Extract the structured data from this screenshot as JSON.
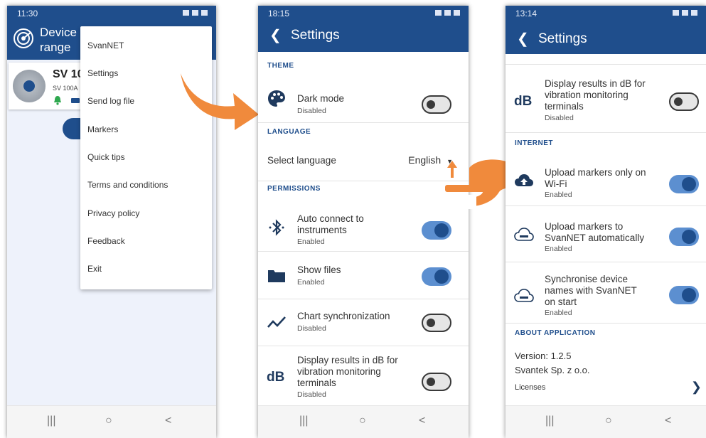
{
  "phone1": {
    "status_time": "11:30",
    "title": "Device\nrange",
    "title_line1": "Device",
    "title_line2": "range",
    "device_name": "SV 10",
    "device_model": "SV 100A",
    "menu_items": [
      "SvanNET",
      "Settings",
      "Send log file",
      "Markers",
      "Quick tips",
      "Terms and conditions",
      "Privacy policy",
      "Feedback",
      "Exit"
    ]
  },
  "phone2": {
    "status_time": "18:15",
    "title": "Settings",
    "theme_section": "THEME",
    "dark_mode_label": "Dark mode",
    "dark_mode_status": "Disabled",
    "language_section": "LANGUAGE",
    "select_language_label": "Select language",
    "language_value": "English",
    "permissions_section": "PERMISSIONS",
    "auto_connect_label_line1": "Auto connect to",
    "auto_connect_label_line2": "instruments",
    "auto_connect_status": "Enabled",
    "show_files_label": "Show files",
    "show_files_status": "Enabled",
    "chart_sync_label": "Chart synchronization",
    "chart_sync_status": "Disabled",
    "db_label_line1": "Display results in dB for",
    "db_label_line2": "vibration monitoring",
    "db_label_line3": "terminals",
    "db_status": "Disabled",
    "db_icon_text": "dB"
  },
  "phone3": {
    "status_time": "13:14",
    "title": "Settings",
    "db_label_line1": "Display results in dB for",
    "db_label_line2": "vibration monitoring",
    "db_label_line3": "terminals",
    "db_status": "Disabled",
    "db_icon_text": "dB",
    "internet_section": "INTERNET",
    "upload_wifi_line1": "Upload markers only on",
    "upload_wifi_line2": "Wi-Fi",
    "upload_wifi_status": "Enabled",
    "upload_svannet_line1": "Upload markers to",
    "upload_svannet_line2": "SvanNET automatically",
    "upload_svannet_status": "Enabled",
    "sync_names_line1": "Synchronise device",
    "sync_names_line2": "names with SvanNET",
    "sync_names_line3": "on start",
    "sync_names_status": "Enabled",
    "about_section": "ABOUT APPLICATION",
    "version": "Version: 1.2.5",
    "company": "Svantek Sp. z o.o.",
    "licenses": "Licenses"
  },
  "colors": {
    "app_bar": "#1f4e8c",
    "toggle_on": "#5c8fd0",
    "arrow": "#f08a3c"
  },
  "nav": {
    "recent": "|||",
    "home": "○",
    "back": "<"
  }
}
